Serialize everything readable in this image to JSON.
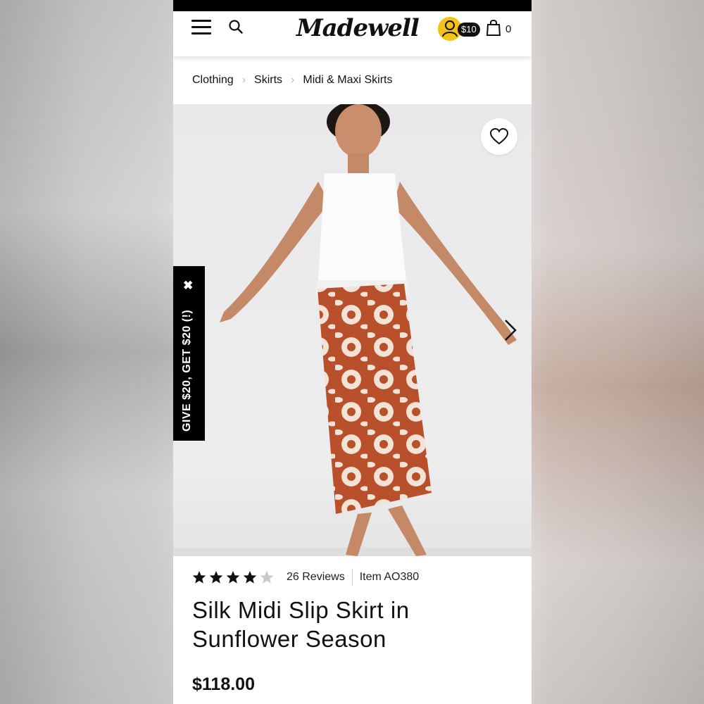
{
  "header": {
    "logo": "Madewell",
    "reward_badge": "$10",
    "bag_count": "0"
  },
  "breadcrumb": [
    "Clothing",
    "Skirts",
    "Midi & Maxi Skirts"
  ],
  "referral": {
    "label": "GIVE $20, GET $20 (!)",
    "close": "✖"
  },
  "product": {
    "rating": 4,
    "rating_max": 5,
    "reviews": "26 Reviews",
    "item_number": "Item AO380",
    "title": "Silk Midi Slip Skirt in Sunflower Season",
    "price": "$118.00"
  },
  "colors": {
    "accent_yellow": "#f3c316",
    "skirt_rust": "#b8502c",
    "black": "#000000"
  },
  "icons": [
    "menu-icon",
    "search-icon",
    "account-icon",
    "bag-icon",
    "heart-icon",
    "chevron-right-icon",
    "star-icon",
    "close-icon"
  ]
}
